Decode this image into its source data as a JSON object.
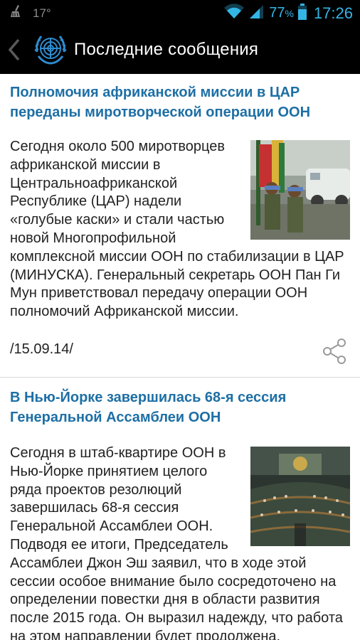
{
  "status_bar": {
    "temperature": "17°",
    "battery_percent": "77",
    "battery_suffix": "%",
    "time": "17:26"
  },
  "action_bar": {
    "title": "Последние сообщения",
    "logo_icon": "un-emblem-icon",
    "back_icon": "chevron-left-icon"
  },
  "articles": [
    {
      "headline": "Полномочия африканской миссии в ЦАР переданы миротворческой операции ООН",
      "body": "Сегодня около 500 миротворцев африканской миссии в Центральноафриканской Республике (ЦАР) надели «голубые каски» и стали частью новой Многопрофильной комплексной миссии ООН по стабилизации в ЦАР (МИНУСКА). Генеральный секретарь ООН Пан Ги Мун приветствовал передачу операции ООН полномочий Африканской миссии.",
      "date": "/15.09.14/",
      "share_icon": "share-icon"
    },
    {
      "headline": "В Нью-Йорке завершилась 68-я сессия Генеральной Ассамблеи ООН",
      "body": "Сегодня в штаб-квартире ООН в Нью-Йорке принятием целого ряда проектов резолюций завершилась 68-я сессия Генеральной Ассамблеи ООН. Подводя ее итоги, Председатель Ассамблеи Джон Эш заявил, что в ходе этой сессии особое внимание было сосредоточено на определении повестки дня в области развития после 2015 года. Он выразил надежду, что работа на этом направлении будет продолжена."
    }
  ],
  "colors": {
    "headline": "#1d6fa5",
    "status_accent": "#33b5e5",
    "bar_background": "#000000"
  }
}
